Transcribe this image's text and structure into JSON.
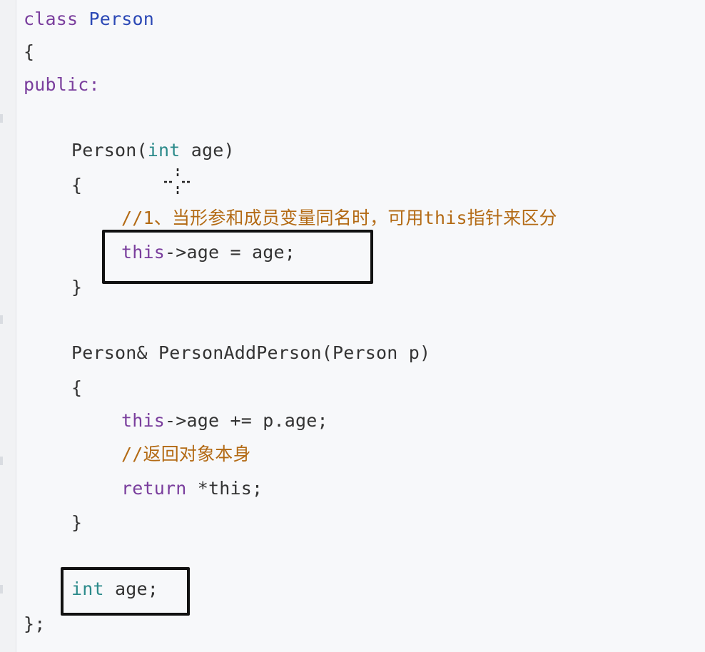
{
  "code": {
    "line1_kw": "class",
    "line1_name": "Person",
    "line2": "{",
    "line3": "public:",
    "ctor_name": "Person(",
    "ctor_type": "int",
    "ctor_rest": " age)",
    "ctor_open": "{",
    "comment1": "//1、当形参和成员变量同名时，可用this指针来区分",
    "assign_this": "this",
    "assign_rest": "->age = age;",
    "ctor_close": "}",
    "method_sig": "Person& PersonAddPerson(Person p)",
    "method_open": "{",
    "addassign_this": "this",
    "addassign_rest": "->age += p.age;",
    "comment2": "//返回对象本身",
    "return_kw": "return",
    "return_rest": " *this;",
    "method_close": "}",
    "member_type": "int",
    "member_rest": " age;",
    "class_close": "};"
  },
  "colors": {
    "keyword": "#7a3e9d",
    "type": "#2b8a8a",
    "class_name": "#2b48b5",
    "comment": "#b36a14",
    "text": "#333333",
    "highlight_border": "#111111"
  }
}
